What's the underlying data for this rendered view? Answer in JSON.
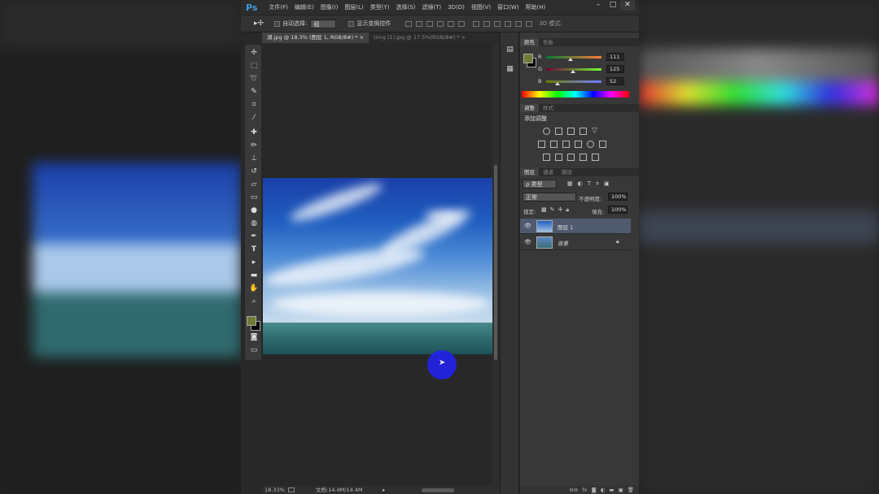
{
  "app": {
    "logo": "Ps",
    "menu": [
      "文件(F)",
      "编辑(E)",
      "图像(I)",
      "图层(L)",
      "类型(Y)",
      "选择(S)",
      "滤镜(T)",
      "3D(D)",
      "视图(V)",
      "窗口(W)",
      "帮助(H)"
    ],
    "window_controls": {
      "minimize": "–",
      "maximize": "□",
      "close": "✕"
    }
  },
  "options_bar": {
    "tool_icon": "move-tool-icon",
    "auto_select_label": "自动选择:",
    "auto_select_value": "组",
    "show_transform_label": "显示变换控件",
    "mode_3d_label": "3D 模式:"
  },
  "tabs": [
    {
      "label": "湖.jpg @ 18.3% (图层 1, RGB/8#) *",
      "close": "×",
      "active": true
    },
    {
      "label": "timg (1).jpg @ 17.5%(RGB/8#) *",
      "close": "×",
      "active": false
    }
  ],
  "status": {
    "zoom": "18.33%",
    "doc": "文档:14.4M/14.4M",
    "arrow": "▸"
  },
  "color_panel": {
    "tabs": [
      "颜色",
      "色板"
    ],
    "r_label": "R",
    "g_label": "G",
    "b_label": "B",
    "r": "111",
    "g": "125",
    "b": "52",
    "r_frac": 0.435,
    "g_frac": 0.49,
    "b_frac": 0.204,
    "foreground": "#6f7d34",
    "background": "#000000"
  },
  "adjust_panel": {
    "tabs": [
      "调整",
      "样式"
    ],
    "title": "添加调整"
  },
  "layers_panel": {
    "tabs": [
      "图层",
      "通道",
      "路径"
    ],
    "kind_label": "ρ 类型",
    "blend_mode": "正常",
    "opacity_label": "不透明度:",
    "opacity_value": "100%",
    "lock_label": "锁定:",
    "fill_label": "填充:",
    "fill_value": "100%",
    "layers": [
      {
        "name": "图层 1",
        "selected": true
      },
      {
        "name": "背景",
        "selected": false,
        "locked": true
      }
    ],
    "footer_icons": [
      "link-icon",
      "fx-icon",
      "mask-icon",
      "adjustment-icon",
      "folder-icon",
      "new-layer-icon",
      "trash-icon"
    ],
    "footer_text": {
      "link": "⊖⊖",
      "fx": "fx"
    }
  }
}
